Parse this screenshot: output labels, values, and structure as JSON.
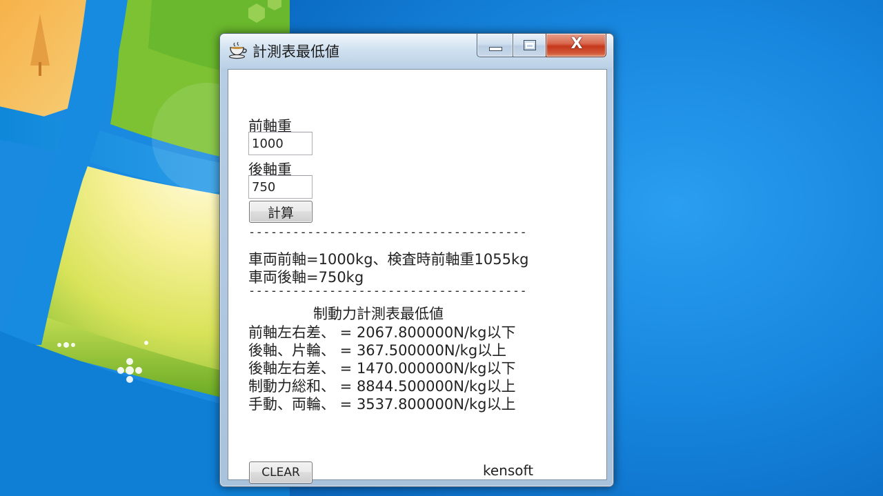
{
  "window": {
    "title": "計測表最低値"
  },
  "form": {
    "front_axle_label": "前軸重",
    "front_axle_value": "1000",
    "rear_axle_label": "後軸重",
    "rear_axle_value": "750",
    "calculate_label": "計算",
    "clear_label": "CLEAR",
    "author": "kensoft"
  },
  "results": {
    "separator": "--------------------------------------",
    "vehicle_front": "車両前軸=1000kg、検査時前軸重1055kg",
    "vehicle_rear": "車両後軸=750kg",
    "table_title": "制動力計測表最低値",
    "lines": [
      "前軸左右差、 = 2067.800000N/kg以下",
      "後軸、片輪、 = 367.500000N/kg以上",
      "後軸左右差、 = 1470.000000N/kg以下",
      "制動力総和、 = 8844.500000N/kg以上",
      "手動、両輪、 = 3537.800000N/kg以上"
    ]
  },
  "colors": {
    "desktop_blue": "#1786de",
    "close_button": "#c5381c"
  }
}
